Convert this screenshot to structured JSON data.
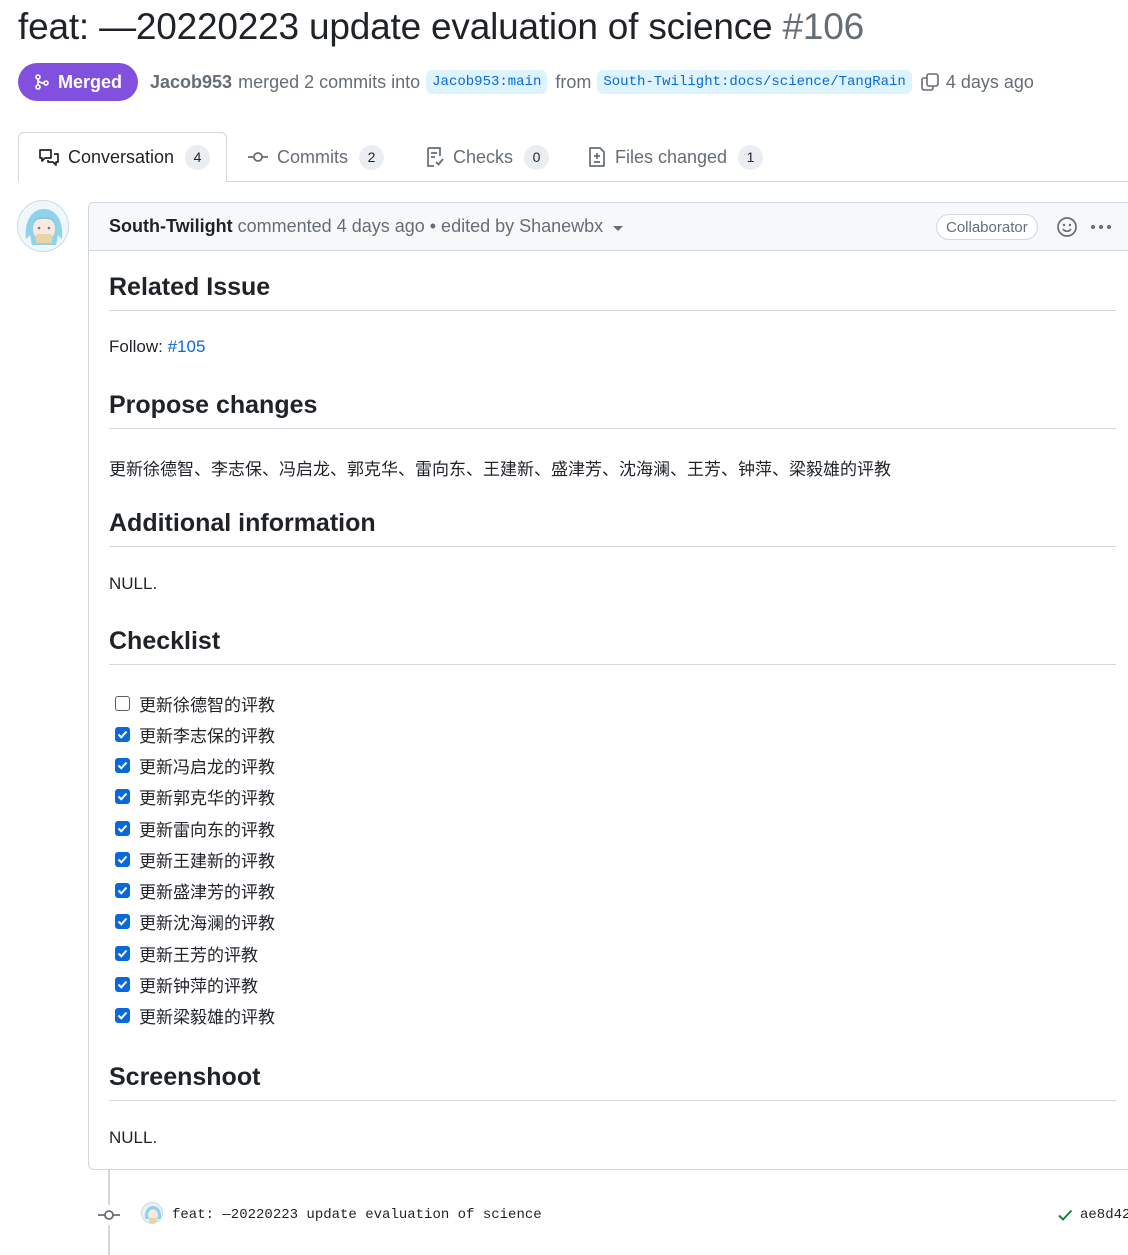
{
  "pr": {
    "title": "feat: —20220223 update evaluation of science",
    "number": "#106",
    "state": "Merged",
    "author": "Jacob953",
    "summary_pre": "merged 2 commits into",
    "base_branch": "Jacob953:main",
    "from_word": "from",
    "head_branch": "South-Twilight:docs/science/TangRain",
    "time": "4 days ago"
  },
  "tabs": [
    {
      "label": "Conversation",
      "count": "4",
      "icon": "comment-discussion-icon"
    },
    {
      "label": "Commits",
      "count": "2",
      "icon": "git-commit-icon"
    },
    {
      "label": "Checks",
      "count": "0",
      "icon": "checklist-icon"
    },
    {
      "label": "Files changed",
      "count": "1",
      "icon": "file-diff-icon"
    }
  ],
  "comment": {
    "author": "South-Twilight",
    "meta": "commented 4 days ago • edited by Shanewbx",
    "role_badge": "Collaborator",
    "sections": {
      "related_issue": {
        "heading": "Related Issue",
        "follow_label": "Follow:",
        "issue_link": "#105"
      },
      "propose": {
        "heading": "Propose changes",
        "text": "更新徐德智、李志保、冯启龙、郭克华、雷向东、王建新、盛津芳、沈海澜、王芳、钟萍、梁毅雄的评教"
      },
      "additional": {
        "heading": "Additional information",
        "text": "NULL."
      },
      "checklist": {
        "heading": "Checklist",
        "items": [
          {
            "label": "更新徐德智的评教",
            "checked": false
          },
          {
            "label": "更新李志保的评教",
            "checked": true
          },
          {
            "label": "更新冯启龙的评教",
            "checked": true
          },
          {
            "label": "更新郭克华的评教",
            "checked": true
          },
          {
            "label": "更新雷向东的评教",
            "checked": true
          },
          {
            "label": "更新王建新的评教",
            "checked": true
          },
          {
            "label": "更新盛津芳的评教",
            "checked": true
          },
          {
            "label": "更新沈海澜的评教",
            "checked": true
          },
          {
            "label": "更新王芳的评教",
            "checked": true
          },
          {
            "label": "更新钟萍的评教",
            "checked": true
          },
          {
            "label": "更新梁毅雄的评教",
            "checked": true
          }
        ]
      },
      "screenshoot": {
        "heading": "Screenshoot",
        "text": "NULL."
      }
    }
  },
  "commit": {
    "message": "feat: —20220223 update evaluation of science",
    "sha": "ae8d42",
    "status": "success"
  },
  "colors": {
    "merged": "#8250df",
    "link": "#0969da",
    "muted": "#656d76",
    "border": "#d0d7de",
    "success": "#1a7f37"
  }
}
